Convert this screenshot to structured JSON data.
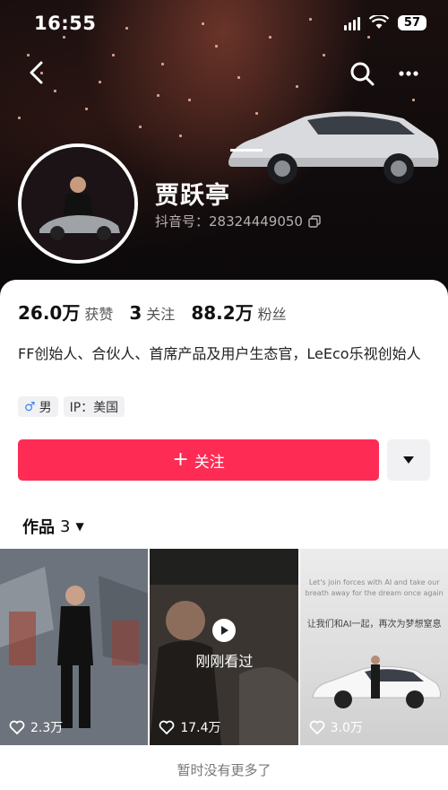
{
  "status_bar": {
    "time": "16:55",
    "battery": "57"
  },
  "profile": {
    "name": "贾跃亭",
    "douyin_id": "抖音号：28324449050"
  },
  "stats": [
    {
      "value": "26.0万",
      "label": "获赞"
    },
    {
      "value": "3",
      "label": "关注"
    },
    {
      "value": "88.2万",
      "label": "粉丝"
    }
  ],
  "bio": "FF创始人、合伙人、首席产品及用户生态官，LeEco乐视创始人",
  "tags": {
    "gender": "男",
    "ip": "IP：美国"
  },
  "actions": {
    "follow_label": "关注",
    "follow_plus": "+"
  },
  "works": {
    "label": "作品",
    "count": "3"
  },
  "videos": [
    {
      "likes": "2.3万"
    },
    {
      "likes": "17.4万",
      "overlay": "刚刚看过"
    },
    {
      "likes": "3.0万",
      "caption_en": "Let's join forces with AI and take our breath away for the dream once again",
      "caption_cn": "让我们和AI一起，再次为梦想窒息"
    }
  ],
  "footer": "暂时没有更多了",
  "colors": {
    "accent": "#fe2c55",
    "male": "#3b82f6"
  }
}
